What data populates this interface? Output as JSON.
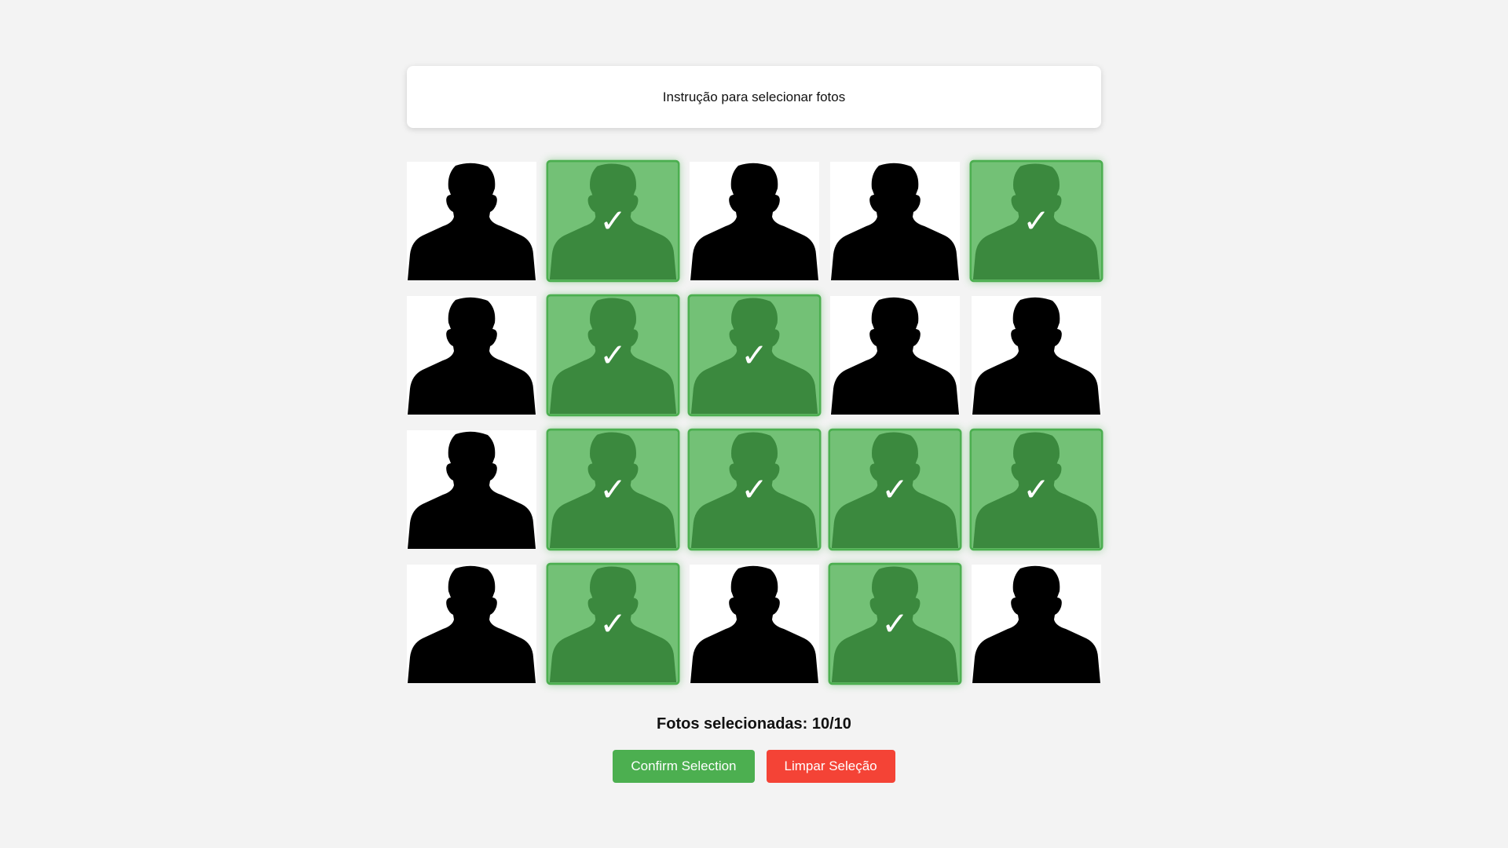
{
  "instruction": "Instrução para selecionar fotos",
  "photos": [
    {
      "selected": false
    },
    {
      "selected": true
    },
    {
      "selected": false
    },
    {
      "selected": false
    },
    {
      "selected": true
    },
    {
      "selected": false
    },
    {
      "selected": true
    },
    {
      "selected": true
    },
    {
      "selected": false
    },
    {
      "selected": false
    },
    {
      "selected": false
    },
    {
      "selected": true
    },
    {
      "selected": true
    },
    {
      "selected": true
    },
    {
      "selected": true
    },
    {
      "selected": false
    },
    {
      "selected": true
    },
    {
      "selected": false
    },
    {
      "selected": true
    },
    {
      "selected": false
    }
  ],
  "check_glyph": "✓",
  "counter": {
    "text": "Fotos selecionadas: 10/10",
    "selected": 10,
    "max": 10
  },
  "buttons": {
    "confirm_label": "Confirm Selection",
    "clear_label": "Limpar Seleção"
  },
  "colors": {
    "accent": "#4caf50",
    "danger": "#f44336",
    "background": "#f3f3f3"
  },
  "icons": {
    "photo": "person-silhouette-icon",
    "check": "checkmark-icon"
  }
}
